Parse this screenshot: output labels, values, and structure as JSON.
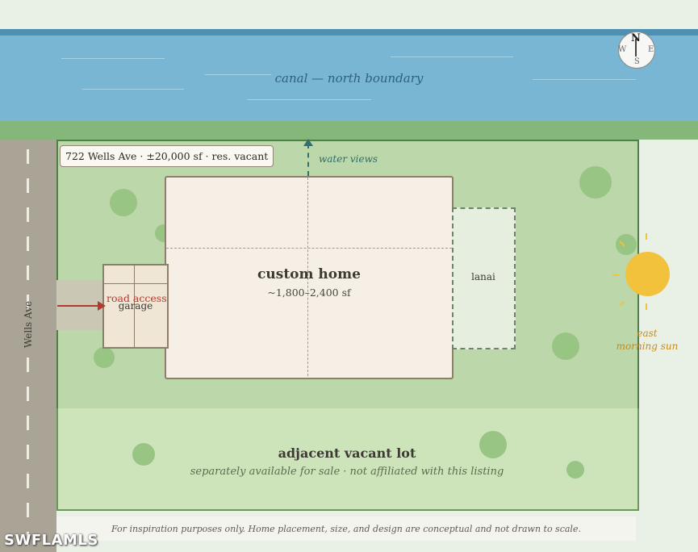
{
  "canal": {
    "label": "canal — north boundary"
  },
  "road": {
    "label": "Wells Ave"
  },
  "lot": {
    "address_label": "722 Wells Ave · ±20,000 sf · res. vacant"
  },
  "home": {
    "title": "custom home",
    "size": "~1,800–2,400 sf"
  },
  "views": {
    "label": "water views"
  },
  "lanai": {
    "label": "lanai"
  },
  "garage": {
    "label": "garage"
  },
  "access": {
    "label": "road access"
  },
  "sun": {
    "label_line1": "east",
    "label_line2": "morning sun"
  },
  "adjacent": {
    "title": "adjacent vacant lot",
    "subtitle": "separately available for sale · not affiliated with this listing"
  },
  "disclaimer": "For inspiration purposes only. Home placement, size, and design are conceptual and not drawn to scale.",
  "compass": {
    "n": "N",
    "s": "S",
    "e": "E",
    "w": "W"
  },
  "watermark": "SWFLAMLS",
  "colors": {
    "canal": "#78b6d3",
    "lot": "#bcd7a9",
    "adjacent_lot": "#cde4bb",
    "home": "#f5efe5",
    "sun": "#f2c23c",
    "access_arrow": "#b33a30"
  }
}
